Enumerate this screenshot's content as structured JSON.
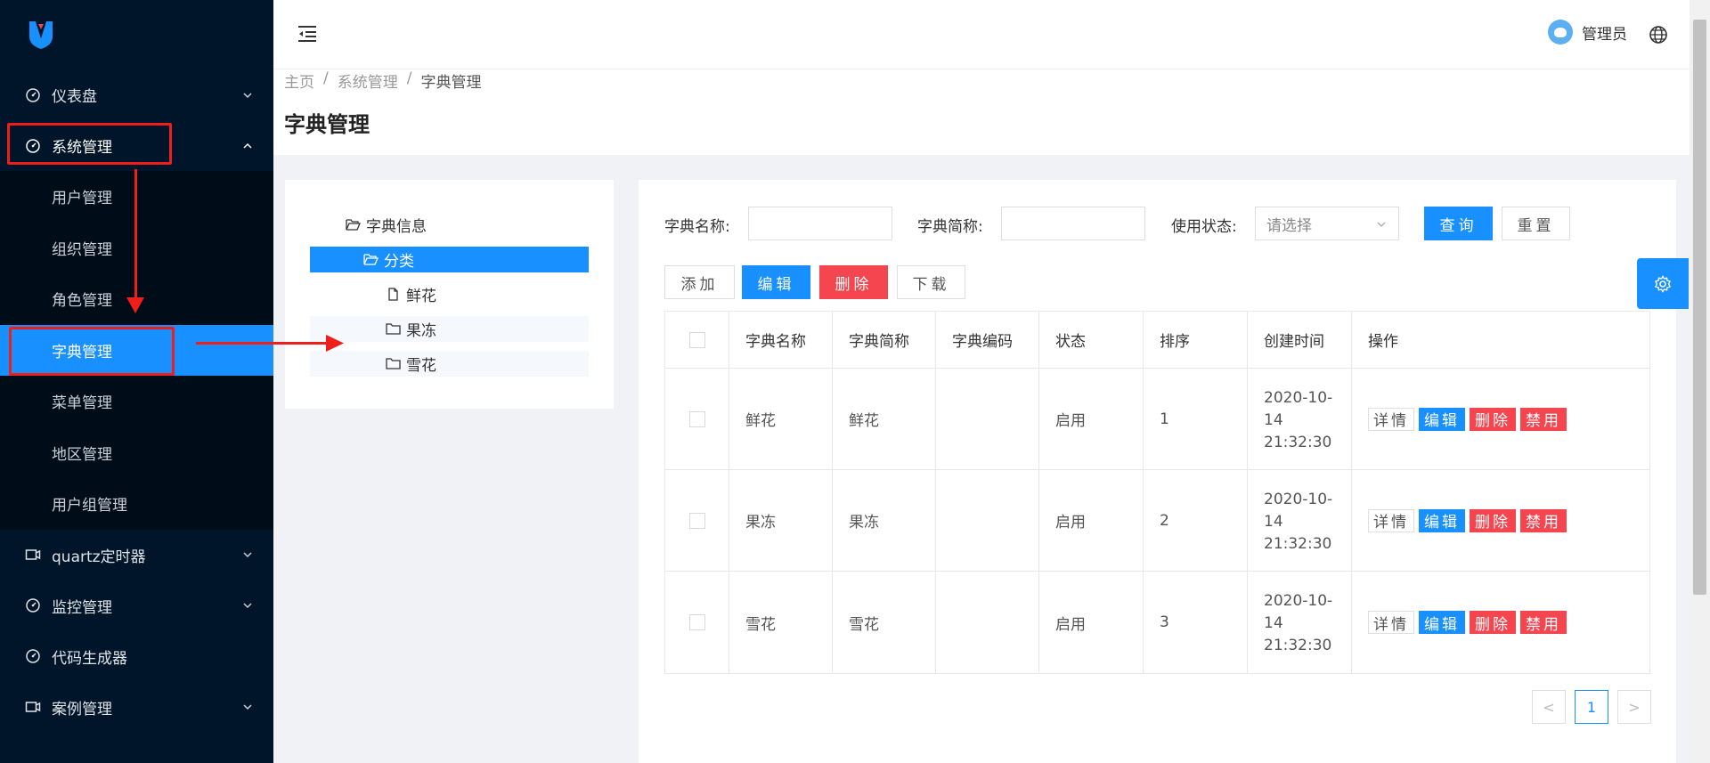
{
  "sidebar": {
    "logo": "logo-icon",
    "items": [
      {
        "label": "仪表盘",
        "icon": "dashboard-icon",
        "has_children": true,
        "expanded": false
      },
      {
        "label": "系统管理",
        "icon": "dashboard-icon",
        "has_children": true,
        "expanded": true
      },
      {
        "label": "quartz定时器",
        "icon": "video-icon",
        "has_children": true,
        "expanded": false
      },
      {
        "label": "监控管理",
        "icon": "dashboard-icon",
        "has_children": true,
        "expanded": false
      },
      {
        "label": "代码生成器",
        "icon": "dashboard-icon",
        "has_children": false
      },
      {
        "label": "案例管理",
        "icon": "video-icon",
        "has_children": true,
        "expanded": false
      }
    ],
    "sub_items": [
      {
        "label": "用户管理"
      },
      {
        "label": "组织管理"
      },
      {
        "label": "角色管理"
      },
      {
        "label": "字典管理",
        "active": true
      },
      {
        "label": "菜单管理"
      },
      {
        "label": "地区管理"
      },
      {
        "label": "用户组管理"
      }
    ]
  },
  "header": {
    "user_name": "管理员"
  },
  "breadcrumb": {
    "home": "主页",
    "sep": "/",
    "parent": "系统管理",
    "current": "字典管理"
  },
  "page_title": "字典管理",
  "tree": {
    "root": "字典信息",
    "selected": "分类",
    "children": [
      "鲜花",
      "果冻",
      "雪花"
    ]
  },
  "filters": {
    "name_label": "字典名称:",
    "abbr_label": "字典简称:",
    "status_label": "使用状态:",
    "status_placeholder": "请选择",
    "query": "查询",
    "reset": "重置"
  },
  "toolbar": {
    "add": "添加",
    "edit": "编辑",
    "delete": "删除",
    "download": "下载"
  },
  "table": {
    "columns": [
      "字典名称",
      "字典简称",
      "字典编码",
      "状态",
      "排序",
      "创建时间",
      "操作"
    ],
    "rows": [
      {
        "name": "鲜花",
        "abbr": "鲜花",
        "code": "",
        "status": "启用",
        "order": "1",
        "time1": "2020-10-",
        "time2": "14",
        "time3": "21:32:30"
      },
      {
        "name": "果冻",
        "abbr": "果冻",
        "code": "",
        "status": "启用",
        "order": "2",
        "time1": "2020-10-",
        "time2": "14",
        "time3": "21:32:30"
      },
      {
        "name": "雪花",
        "abbr": "雪花",
        "code": "",
        "status": "启用",
        "order": "3",
        "time1": "2020-10-",
        "time2": "14",
        "time3": "21:32:30"
      }
    ],
    "ops": {
      "detail": "详情",
      "edit": "编辑",
      "delete": "删除",
      "disable": "禁用"
    }
  },
  "pagination": {
    "prev": "<",
    "current": "1",
    "next": ">"
  },
  "colors": {
    "sidebar_bg": "#001529",
    "primary": "#1890ff",
    "danger": "#f5454f",
    "annotation": "#f01d1d"
  }
}
